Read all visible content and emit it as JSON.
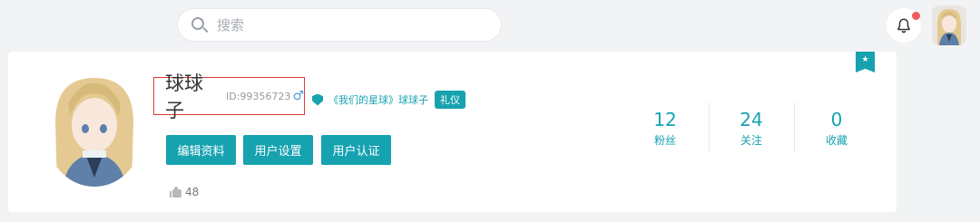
{
  "header": {
    "search": {
      "placeholder": "搜索",
      "icon": "search-icon"
    },
    "notification": {
      "icon": "bell-icon",
      "has_unread": true,
      "dot_color": "#f05a5a"
    },
    "avatar": {
      "icon": "user-avatar"
    }
  },
  "profile": {
    "username": "球球子",
    "id": "ID:99356723",
    "gender_symbol": "♂",
    "verification": {
      "text": "《我们的星球》球球子",
      "tag": "礼仪"
    },
    "buttons": {
      "edit": "编辑资料",
      "settings": "用户设置",
      "verify": "用户认证"
    },
    "likes": "48",
    "corner_badge_icon": "star-badge-icon"
  },
  "stats": [
    {
      "value": "12",
      "label": "粉丝"
    },
    {
      "value": "24",
      "label": "关注"
    },
    {
      "value": "0",
      "label": "收藏"
    }
  ],
  "colors": {
    "accent": "#17a2b0",
    "highlight_border": "#e53935"
  }
}
